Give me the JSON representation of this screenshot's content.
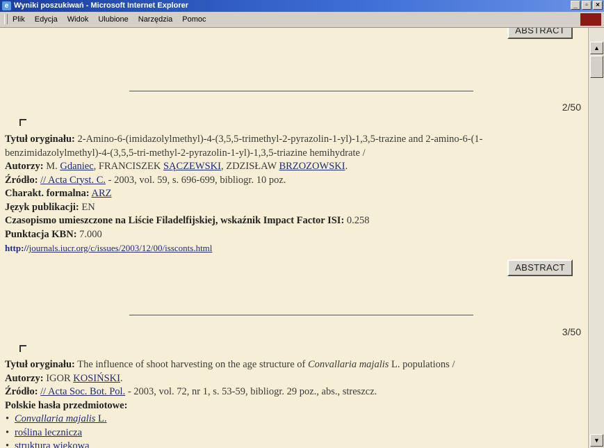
{
  "window": {
    "title": "Wyniki poszukiwań - Microsoft Internet Explorer",
    "min_label": "_",
    "max_label": "▫",
    "close_label": "×"
  },
  "menu": [
    "Plik",
    "Edycja",
    "Widok",
    "Ulubione",
    "Narzędzia",
    "Pomoc"
  ],
  "buttons": {
    "abstract": "ABSTRACT"
  },
  "records": [
    {
      "counter": "2/50",
      "title_label": "Tytuł oryginału:",
      "title": "2-Amino-6-(imidazolylmethyl)-4-(3,5,5-trimethyl-2-pyrazolin-1-yl)-1,3,5-trazine and 2-amino-6-(1-benzimidazolylmethyl)-4-(3,5,5-tri-methyl-2-pyrazolin-1-yl)-1,3,5-triazine hemihydrate /",
      "authors_label": "Autorzy:",
      "authors": [
        {
          "first": "M.",
          "last": "Gdaniec",
          "sep": ", "
        },
        {
          "first": "FRANCISZEK",
          "last": "SĄCZEWSKI",
          "sep": ", "
        },
        {
          "first": "ZDZISŁAW",
          "last": "BRZOZOWSKI",
          "sep": ""
        }
      ],
      "authors_end": ".",
      "source_label": "Źródło:",
      "source_link": "// Acta Cryst. C.",
      "source_rest": " - 2003, vol. 59, s. 696-699, bibliogr. 10 poz.",
      "format_label": "Charakt. formalna:",
      "format": "ARZ",
      "lang_label": "Język publikacji:",
      "lang": "EN",
      "journal_label": "Czasopismo umieszczone na Liście Filadelfijskiej, wskaźnik Impact Factor ISI:",
      "impact": "0.258",
      "kbn_label": "Punktacja KBN:",
      "kbn": "7.000",
      "url_prefix": "http://",
      "url_link": "journals.iucr.org/c/issues/2003/12/00/issconts.html"
    },
    {
      "counter": "3/50",
      "title_label": "Tytuł oryginału:",
      "title_pre": "The influence of shoot harvesting on the age structure of ",
      "title_italic": "Convallaria majalis",
      "title_post": " L. populations /",
      "authors_label": "Autorzy:",
      "author_first": "IGOR",
      "author_last": "KOSIŃSKI",
      "authors_end": ".",
      "source_label": "Źródło:",
      "source_link": "// Acta Soc. Bot. Pol.",
      "source_rest": " - 2003, vol. 72, nr 1, s. 53-59, bibliogr. 29 poz., abs., streszcz.",
      "keywords_label": "Polskie hasła przedmiotowe:",
      "keyword1_italic": "Convallaria majalis",
      "keyword1_rest": " L.",
      "keyword2": "roślina lecznicza",
      "keyword3": "struktura wiekowa"
    }
  ]
}
